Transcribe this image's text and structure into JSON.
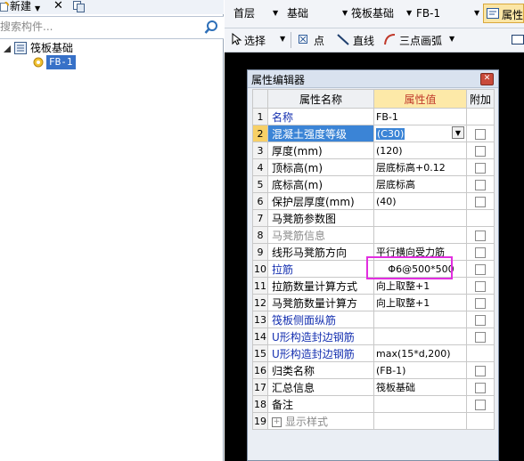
{
  "left": {
    "toolbar": {
      "new_label": "新建",
      "delete_glyph": "✕"
    },
    "search": {
      "placeholder": "搜索构件..."
    },
    "tree": {
      "root_label": "筏板基础",
      "child_label": "FB-1"
    }
  },
  "right": {
    "toolbar1": {
      "floor": "首层",
      "type": "基础",
      "category": "筏板基础",
      "component": "FB-1",
      "props_label": "属性"
    },
    "toolbar2": {
      "select_label": "选择",
      "point_label": "点",
      "line_label": "直线",
      "arc_label": "三点画弧"
    }
  },
  "dialog": {
    "title": "属性编辑器",
    "headers": {
      "name": "属性名称",
      "value": "属性值",
      "extra": "附加"
    },
    "rows": [
      {
        "num": "1",
        "name": "名称",
        "value": "FB-1"
      },
      {
        "num": "2",
        "name": "混凝土强度等级",
        "value": "(C30)"
      },
      {
        "num": "3",
        "name": "厚度(mm)",
        "value": "(120)"
      },
      {
        "num": "4",
        "name": "顶标高(m)",
        "value": "层底标高+0.12"
      },
      {
        "num": "5",
        "name": "底标高(m)",
        "value": "层底标高"
      },
      {
        "num": "6",
        "name": "保护层厚度(mm)",
        "value": "(40)"
      },
      {
        "num": "7",
        "name": "马凳筋参数图",
        "value": ""
      },
      {
        "num": "8",
        "name": "马凳筋信息",
        "value": ""
      },
      {
        "num": "9",
        "name": "线形马凳筋方向",
        "value": "平行横向受力筋"
      },
      {
        "num": "10",
        "name": "拉筋",
        "value": "Φ6@500*500"
      },
      {
        "num": "11",
        "name": "拉筋数量计算方式",
        "value": "向上取整+1"
      },
      {
        "num": "12",
        "name": "马凳筋数量计算方",
        "value": "向上取整+1"
      },
      {
        "num": "13",
        "name": "筏板侧面纵筋",
        "value": ""
      },
      {
        "num": "14",
        "name": "U形构造封边钢筋",
        "value": ""
      },
      {
        "num": "15",
        "name": "U形构造封边钢筋",
        "value": "max(15*d,200)"
      },
      {
        "num": "16",
        "name": "归类名称",
        "value": "(FB-1)"
      },
      {
        "num": "17",
        "name": "汇总信息",
        "value": "筏板基础"
      },
      {
        "num": "18",
        "name": "备注",
        "value": ""
      },
      {
        "num": "19",
        "name": "显示样式",
        "value": ""
      }
    ]
  }
}
